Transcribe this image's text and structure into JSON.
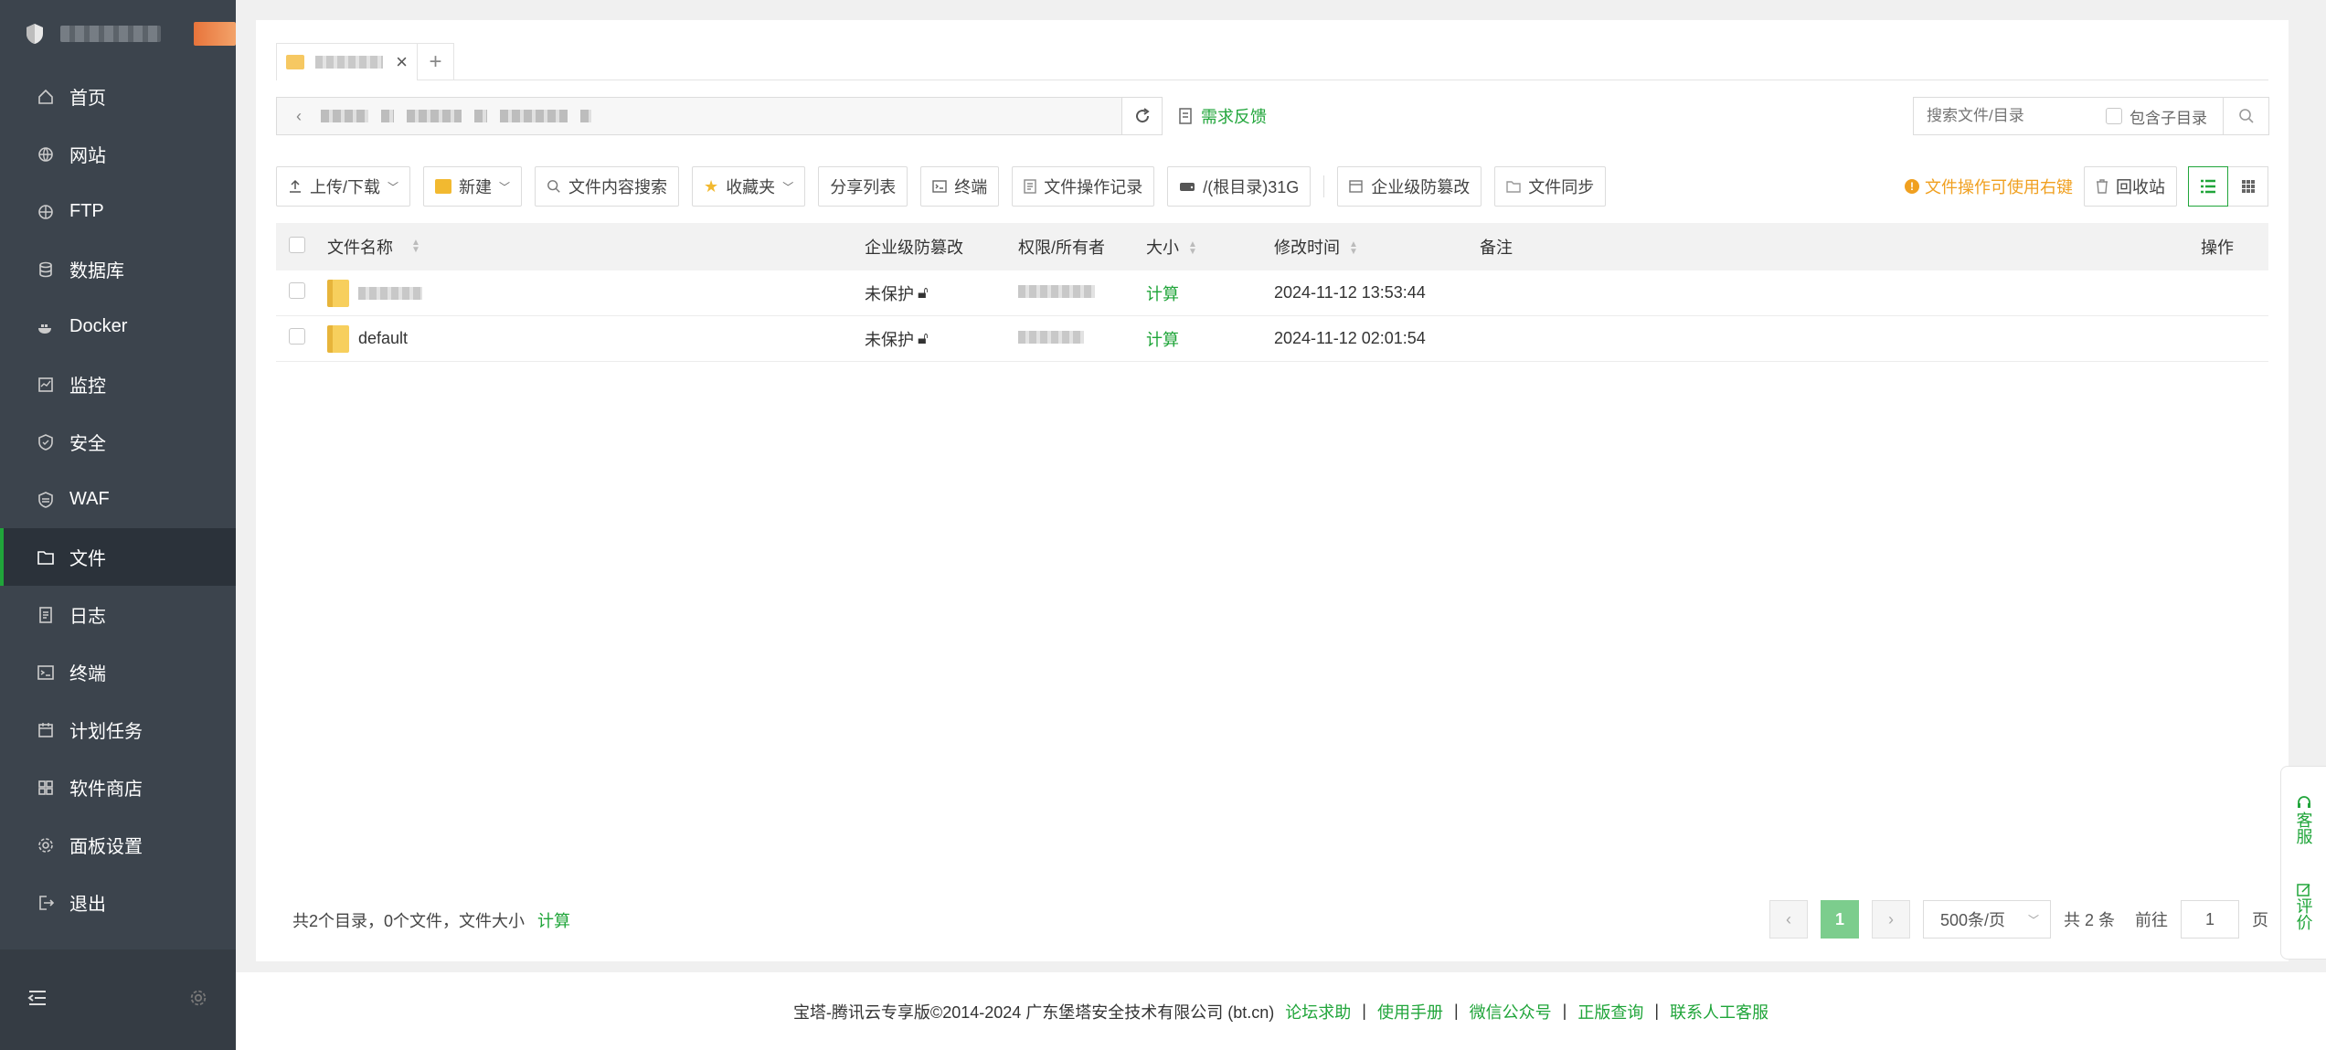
{
  "sidebar": {
    "items": [
      {
        "label": "首页",
        "icon": "home-icon"
      },
      {
        "label": "网站",
        "icon": "globe-icon"
      },
      {
        "label": "FTP",
        "icon": "ftp-icon"
      },
      {
        "label": "数据库",
        "icon": "database-icon"
      },
      {
        "label": "Docker",
        "icon": "docker-icon"
      },
      {
        "label": "监控",
        "icon": "monitor-icon"
      },
      {
        "label": "安全",
        "icon": "shield-icon"
      },
      {
        "label": "WAF",
        "icon": "waf-icon"
      },
      {
        "label": "文件",
        "icon": "folder-icon",
        "active": true
      },
      {
        "label": "日志",
        "icon": "log-icon"
      },
      {
        "label": "终端",
        "icon": "terminal-icon"
      },
      {
        "label": "计划任务",
        "icon": "calendar-icon"
      },
      {
        "label": "软件商店",
        "icon": "apps-icon"
      },
      {
        "label": "面板设置",
        "icon": "gear-icon"
      },
      {
        "label": "退出",
        "icon": "logout-icon"
      }
    ]
  },
  "pathbar": {
    "feedback": "需求反馈"
  },
  "search": {
    "placeholder": "搜索文件/目录",
    "include_sub": "包含子目录"
  },
  "toolbar": {
    "upload": "上传/下载",
    "new": "新建",
    "content_search": "文件内容搜索",
    "favorites": "收藏夹",
    "share_list": "分享列表",
    "terminal": "终端",
    "op_log": "文件操作记录",
    "disk": "/(根目录)31G",
    "tamper": "企业级防篡改",
    "sync": "文件同步",
    "tip": "文件操作可使用右键",
    "recycle": "回收站"
  },
  "table": {
    "headers": {
      "name": "文件名称",
      "protect": "企业级防篡改",
      "perm": "权限/所有者",
      "size": "大小",
      "mtime": "修改时间",
      "note": "备注",
      "op": "操作"
    },
    "rows": [
      {
        "name": "",
        "protect": "未保护",
        "size": "计算",
        "mtime": "2024-11-12 13:53:44"
      },
      {
        "name": "default",
        "protect": "未保护",
        "size": "计算",
        "mtime": "2024-11-12 02:01:54"
      }
    ]
  },
  "summary": {
    "text": "共2个目录，0个文件，文件大小",
    "calc": "计算"
  },
  "pager": {
    "current": "1",
    "page_size": "500条/页",
    "total": "共 2 条",
    "goto_label": "前往",
    "goto_value": "1",
    "page_unit": "页"
  },
  "footer": {
    "copyright": "宝塔-腾讯云专享版©2014-2024 广东堡塔安全技术有限公司 (bt.cn)",
    "links": [
      "论坛求助",
      "使用手册",
      "微信公众号",
      "正版查询",
      "联系人工客服"
    ]
  },
  "float": {
    "service": "客服",
    "review": "评价"
  },
  "colors": {
    "accent": "#20a53a",
    "sidebar_bg": "#3c444d",
    "warning": "#f0a020"
  }
}
